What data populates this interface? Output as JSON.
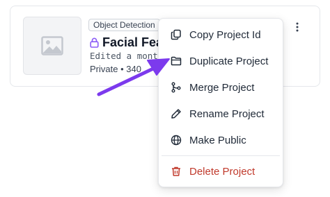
{
  "card": {
    "type_badge": "Object Detection",
    "title": "Facial Fea",
    "edited": "Edited a mont",
    "meta": "Private • 340"
  },
  "menu": {
    "items": [
      {
        "label": "Copy Project Id",
        "icon": "copy-icon"
      },
      {
        "label": "Duplicate Project",
        "icon": "folder-icon"
      },
      {
        "label": "Merge Project",
        "icon": "git-merge-icon"
      },
      {
        "label": "Rename Project",
        "icon": "pencil-icon"
      },
      {
        "label": "Make Public",
        "icon": "globe-icon"
      }
    ],
    "danger_item": {
      "label": "Delete Project",
      "icon": "trash-icon"
    }
  },
  "colors": {
    "accent_purple": "#7c3aed",
    "danger_red": "#c0392b"
  }
}
